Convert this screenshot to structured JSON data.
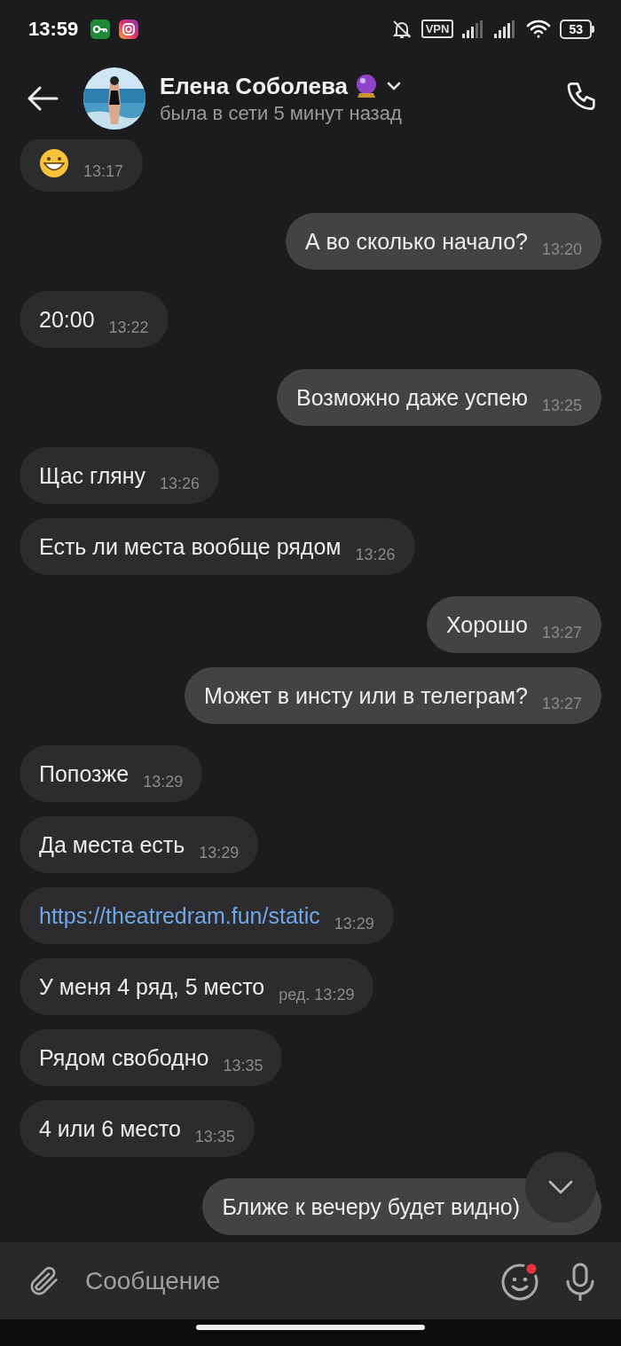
{
  "status_bar": {
    "time": "13:59",
    "vpn": "VPN",
    "battery": "53"
  },
  "header": {
    "name": "Елена Соболева",
    "status": "была в сети 5 минут назад"
  },
  "messages": [
    {
      "kind": "emoji",
      "outgoing": false,
      "time": "13:17"
    },
    {
      "kind": "text",
      "outgoing": true,
      "text": "А во сколько начало?",
      "time": "13:20"
    },
    {
      "kind": "text",
      "outgoing": false,
      "text": "20:00",
      "time": "13:22"
    },
    {
      "kind": "text",
      "outgoing": true,
      "text": "Возможно даже успею",
      "time": "13:25"
    },
    {
      "kind": "text",
      "outgoing": false,
      "text": "Щас гляну",
      "time": "13:26"
    },
    {
      "kind": "text",
      "outgoing": false,
      "text": "Есть ли места вообще рядом",
      "time": "13:26"
    },
    {
      "kind": "text",
      "outgoing": true,
      "text": "Хорошо",
      "time": "13:27"
    },
    {
      "kind": "text",
      "outgoing": true,
      "text": "Может в инсту или в телеграм?",
      "time": "13:27"
    },
    {
      "kind": "text",
      "outgoing": false,
      "text": "Попозже",
      "time": "13:29"
    },
    {
      "kind": "text",
      "outgoing": false,
      "text": "Да места есть",
      "time": "13:29"
    },
    {
      "kind": "link",
      "outgoing": false,
      "text": "https://theatredram.fun/static",
      "time": "13:29"
    },
    {
      "kind": "text",
      "outgoing": false,
      "text": "У меня 4 ряд, 5 место",
      "edited": "ред.",
      "time": "13:29"
    },
    {
      "kind": "text",
      "outgoing": false,
      "text": "Рядом свободно",
      "time": "13:35"
    },
    {
      "kind": "text",
      "outgoing": false,
      "text": "4 или 6 место",
      "time": "13:35"
    },
    {
      "kind": "text",
      "outgoing": true,
      "text": "Ближе к вечеру будет видно)"
    }
  ],
  "composer": {
    "placeholder": "Сообщение"
  }
}
